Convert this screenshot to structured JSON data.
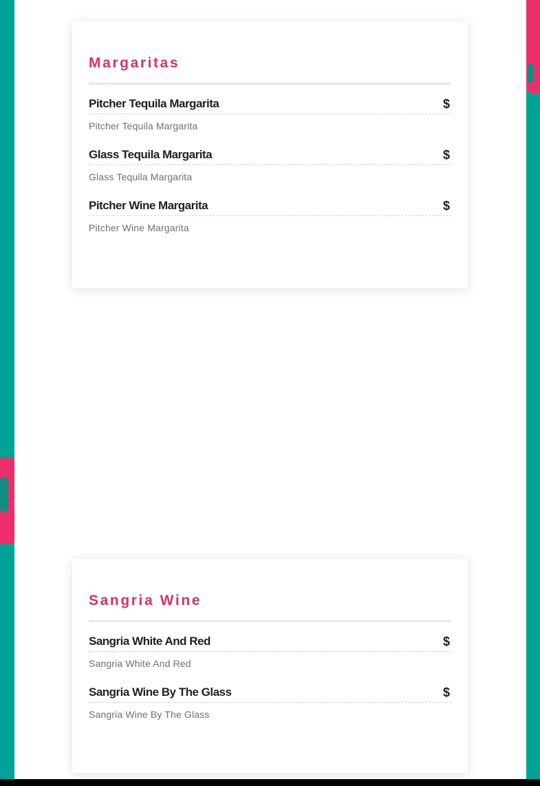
{
  "colors": {
    "background_teal": "#00a396",
    "accent_pink": "#ec2f6b",
    "title_pink": "#d9306b",
    "panel_white": "#ffffff",
    "item_text": "#1f1f1f",
    "desc_text": "#6f6f6f"
  },
  "sections": [
    {
      "title": "Margaritas",
      "items": [
        {
          "name": "Pitcher Tequila Margarita",
          "price": "$",
          "description": "Pitcher Tequila Margarita"
        },
        {
          "name": "Glass Tequila Margarita",
          "price": "$",
          "description": "Glass Tequila Margarita"
        },
        {
          "name": "Pitcher Wine Margarita",
          "price": "$",
          "description": "Pitcher Wine Margarita"
        }
      ]
    },
    {
      "title": "Sangria Wine",
      "items": [
        {
          "name": "Sangria White And Red",
          "price": "$",
          "description": "Sangria White And Red"
        },
        {
          "name": "Sangria Wine By The Glass",
          "price": "$",
          "description": "Sangria Wine By The Glass"
        }
      ]
    }
  ]
}
